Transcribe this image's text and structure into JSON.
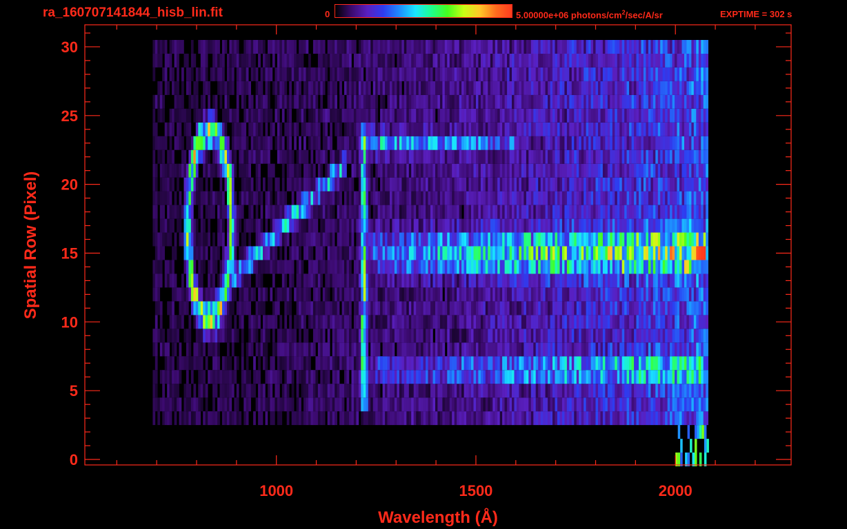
{
  "header": {
    "filename": "ra_160707141844_hisb_lin.fit",
    "colorbar_min": "0",
    "colorbar_max_prefix": "5.00000e+06 photons/cm",
    "colorbar_max_sup": "2",
    "colorbar_max_suffix": "/sec/A/sr",
    "exptime": "EXPTIME = 302 s"
  },
  "colors": {
    "axis": "#ff2a1a",
    "background": "#000000",
    "colormap": [
      "#000000",
      "#3b0a6e",
      "#5a1fc0",
      "#2e3cf0",
      "#1e8cff",
      "#19e6ff",
      "#1eff8c",
      "#46ff1e",
      "#c8ff14",
      "#ffc828",
      "#ff6e1e",
      "#ff3c1e"
    ]
  },
  "chart_data": {
    "type": "heatmap",
    "title": "ra_160707141844_hisb_lin.fit",
    "xlabel": "Wavelength (Å)",
    "ylabel": "Spatial Row (Pixel)",
    "xlim": [
      520,
      2290
    ],
    "ylim": [
      -0.4,
      31.6
    ],
    "xticks": [
      1000,
      1500,
      2000
    ],
    "yticks": [
      0,
      5,
      10,
      15,
      20,
      25,
      30
    ],
    "colorbar_range": [
      0,
      5000000
    ],
    "colorbar_units": "photons/cm^2/sec/A/sr",
    "exptime_s": 302,
    "data_x_range": [
      690,
      2080
    ],
    "data_y_range": [
      0,
      30
    ],
    "features": [
      {
        "name": "ring",
        "center_wavelength": 830,
        "center_row": 17,
        "wavelength_half_width": 55,
        "row_half_height": 6.8,
        "level": 0.62
      },
      {
        "name": "line",
        "wavelength": 1216,
        "rows": [
          4,
          24
        ],
        "level": 0.55
      },
      {
        "name": "diagonal streak",
        "from": [
          880,
          13
        ],
        "to": [
          1170,
          21.5
        ],
        "level": 0.42
      },
      {
        "name": "band",
        "rows": [
          13,
          18
        ],
        "wavelength_range": [
          1216,
          2070
        ],
        "peak_row": 15,
        "level_start": 0.3,
        "level_end": 0.72
      },
      {
        "name": "band",
        "rows": [
          21.5,
          24
        ],
        "wavelength_range": [
          1216,
          1600
        ],
        "peak_row": 23,
        "level_start": 0.4,
        "level_end": 0.3
      },
      {
        "name": "band",
        "rows": [
          5,
          8
        ],
        "wavelength_range": [
          1216,
          2070
        ],
        "peak_row": 6.5,
        "level_start": 0.25,
        "level_end": 0.55
      }
    ]
  }
}
